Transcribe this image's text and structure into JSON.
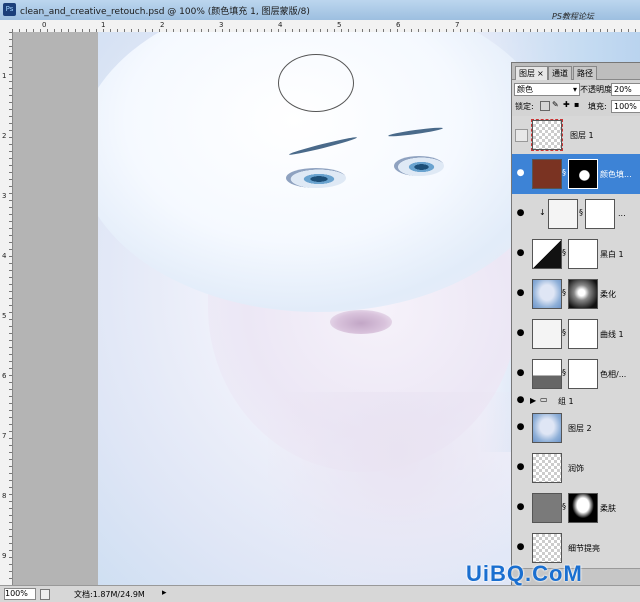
{
  "window": {
    "title": "clean_and_creative_retouch.psd @ 100% (颜色填充 1, 图层蒙版/8)",
    "watermark": "PS教程论坛 BBS.16XX8.COM"
  },
  "rulers": {
    "top_labels": [
      "0",
      "1",
      "2",
      "3",
      "4",
      "5",
      "6",
      "7"
    ],
    "left_labels": [
      "1",
      "2",
      "3",
      "4",
      "5",
      "6",
      "7",
      "8",
      "9"
    ]
  },
  "status": {
    "zoom": "100%",
    "doc": "文档:1.87M/24.9M"
  },
  "layers_panel": {
    "tabs": [
      {
        "label": "图层",
        "close": "×"
      },
      {
        "label": "通道"
      },
      {
        "label": "路径"
      }
    ],
    "blend_mode": "颜色",
    "opacity_label": "不透明度:",
    "opacity": "20%",
    "lock_label": "锁定:",
    "fill_label": "填充:",
    "fill": "100%",
    "layers": [
      {
        "name": "图层 1"
      },
      {
        "name": "颜色填..."
      },
      {
        "name": "..."
      },
      {
        "name": "黑白 1"
      },
      {
        "name": "柔化"
      },
      {
        "name": "曲线 1"
      },
      {
        "name": "色相/..."
      },
      {
        "name": "组 1"
      },
      {
        "name": "图层 2"
      },
      {
        "name": "润饰"
      },
      {
        "name": "柔肤"
      },
      {
        "name": "细节提亮"
      }
    ]
  },
  "logo": "UiBQ.CoM"
}
